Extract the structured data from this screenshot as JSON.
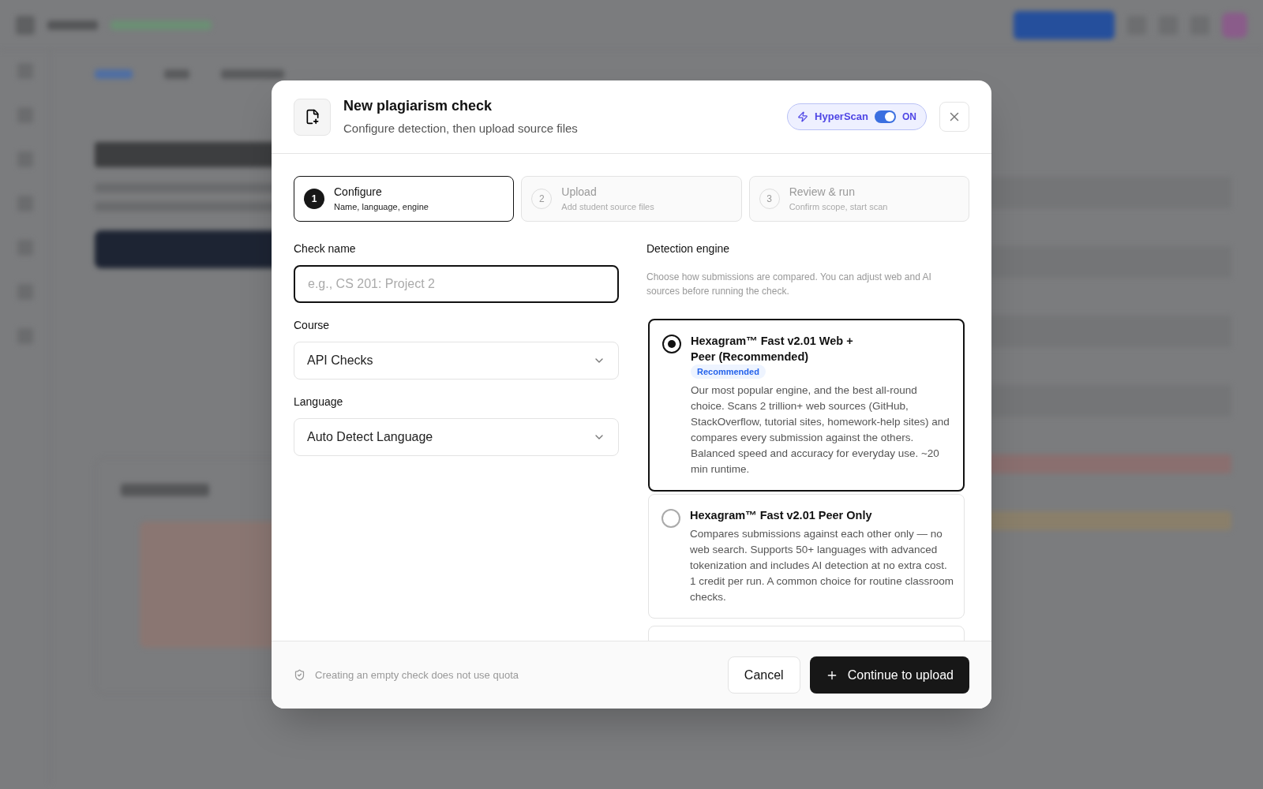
{
  "dialog": {
    "title": "New plagiarism check",
    "subtitle": "Configure detection, then upload source files",
    "hyperscan": {
      "label": "HyperScan",
      "on": true,
      "state_label": "ON"
    },
    "steps": [
      {
        "number": "1",
        "title": "Configure",
        "subtitle": "Name, language, engine",
        "selected": true
      },
      {
        "number": "2",
        "title": "Upload",
        "subtitle": "Add student source files",
        "selected": false
      },
      {
        "number": "3",
        "title": "Review & run",
        "subtitle": "Confirm scope, start scan",
        "selected": false
      }
    ],
    "fields": [
      {
        "kind": "text",
        "label": "Check name",
        "placeholder": "e.g., CS 201: Project 2",
        "focused": true
      },
      {
        "kind": "select",
        "label": "Course",
        "value": "API Checks",
        "focused": false
      },
      {
        "kind": "select",
        "label": "Language",
        "value": "Auto Detect Language",
        "focused": false
      }
    ],
    "engine": {
      "label": "Detection engine",
      "hint": "Choose how submissions are compared. You can adjust web and AI sources before running the check.",
      "options": [
        {
          "name": "Hexagram™ Fast v2.01 Web + Peer (Recommended)",
          "badge": "Recommended",
          "description": "Our most popular engine, and the best all-round choice. Scans 2 trillion+ web sources (GitHub, StackOverflow, tutorial sites, homework-help sites) and compares every submission against the others. Balanced speed and accuracy for everyday use. ~20 min runtime.",
          "selected": true
        },
        {
          "name": "Hexagram™ Fast v2.01 Peer Only",
          "description": "Compares submissions against each other only — no web search. Supports 50+ languages with advanced tokenization and includes AI detection at no extra cost. 1 credit per run. A common choice for routine classroom checks.",
          "selected": false
        }
      ]
    },
    "footer_note": "Creating an empty check does not use quota",
    "buttons": [
      {
        "kind": "secondary",
        "label": "Cancel"
      },
      {
        "kind": "primary",
        "label": "Continue to upload"
      }
    ]
  }
}
